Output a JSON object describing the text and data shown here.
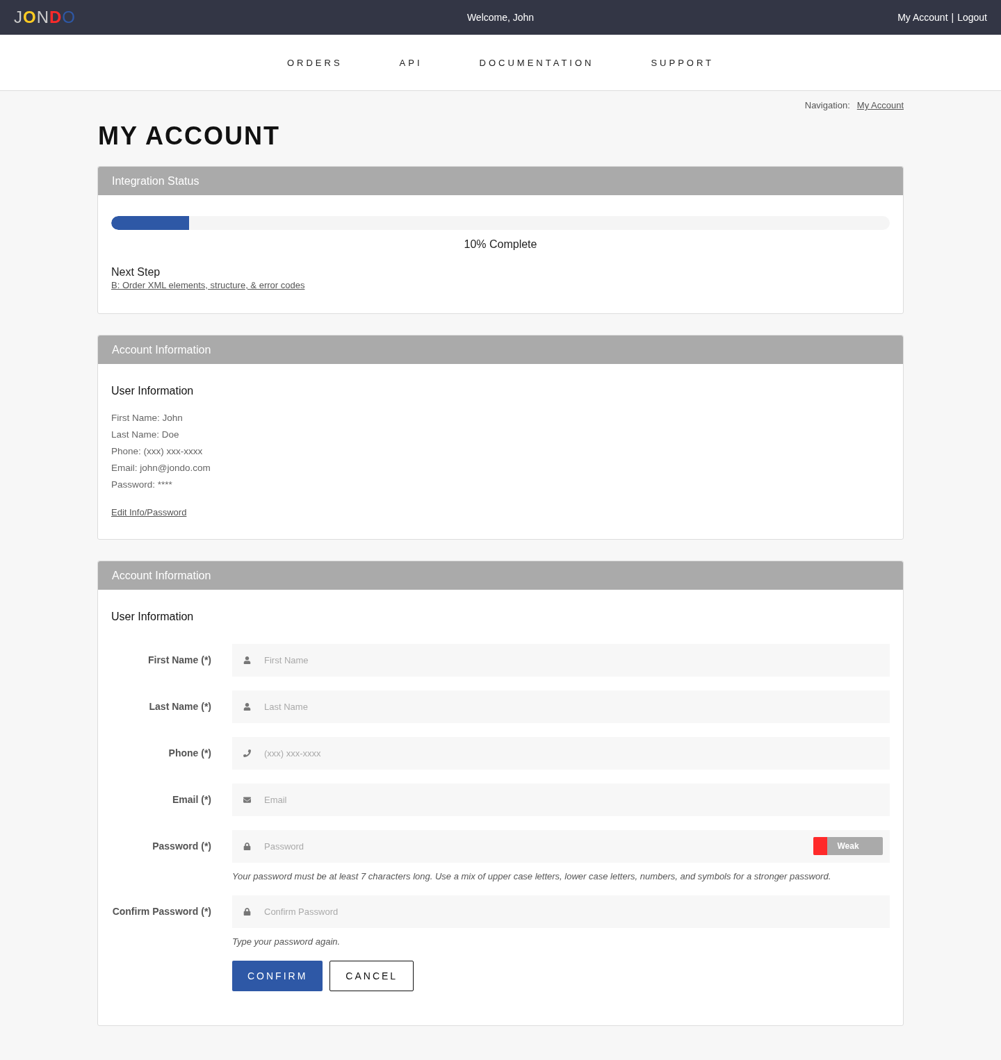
{
  "topbar": {
    "logo": "JONDO",
    "welcome": "Welcome, John",
    "links": [
      "My Account",
      "Logout"
    ],
    "separator": "|"
  },
  "nav": [
    "ORDERS",
    "API",
    "DOCUMENTATION",
    "SUPPORT"
  ],
  "breadcrumb": {
    "label": "Navigation:",
    "link": "My Account"
  },
  "title": "MY ACCOUNT",
  "integration": {
    "header": "Integration Status",
    "level": 0.1,
    "reading": "10% Complete",
    "next_label": "Next Step",
    "next_link": "B: Order XML elements, structure, & error codes"
  },
  "account_info": {
    "header": "Account Information",
    "subtitle": "User Information",
    "lines": [
      "First Name: John",
      "Last Name: Doe",
      "Phone: (xxx) xxx-xxxx",
      "Email: john@jondo.com",
      "Password: ****"
    ],
    "edit_link": "Edit Info/Password"
  },
  "account_form": {
    "header": "Account Information",
    "subtitle": "User Information",
    "fields": [
      {
        "label": "First Name (*)",
        "kind": "person",
        "placeholder": "First Name"
      },
      {
        "label": "Last Name (*)",
        "kind": "person",
        "placeholder": "Last Name"
      },
      {
        "label": "Phone (*)",
        "kind": "phone",
        "placeholder": "(xxx) xxx-xxxx"
      },
      {
        "label": "Email (*)",
        "kind": "email",
        "placeholder": "Email"
      },
      {
        "label": "Password (*)",
        "kind": "password",
        "placeholder": "Password",
        "strength": {
          "level": 0.2,
          "label": "Weak"
        },
        "hint": "Your password must be at least 7 characters long. Use a mix of upper case letters, lower case letters, numbers, and symbols for a stronger password."
      },
      {
        "label": "Confirm Password (*)",
        "kind": "password",
        "placeholder": "Confirm Password",
        "hint": "Type your password again."
      }
    ],
    "buttons": [
      {
        "label": "CONFIRM",
        "kind": "primary"
      },
      {
        "label": "CANCEL",
        "kind": "secondary"
      }
    ]
  }
}
